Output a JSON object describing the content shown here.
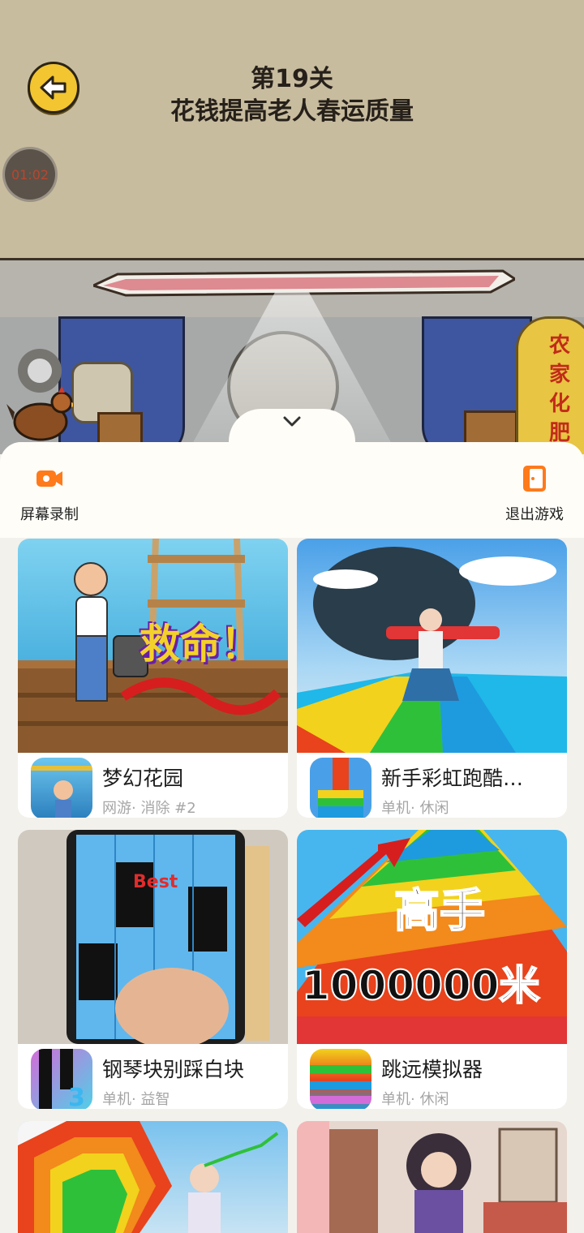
{
  "game": {
    "level_number": "第19关",
    "level_title": "花钱提高老人春运质量",
    "timer": "01:02",
    "sack_text": "农家化肥"
  },
  "toolbar": {
    "record_label": "屏幕录制",
    "exit_label": "退出游戏",
    "accent_color": "#ff7a1a"
  },
  "games": [
    {
      "name": "梦幻花园",
      "tags": "网游· 消除 #2",
      "thumb_caption": "救命！"
    },
    {
      "name": "新手彩虹跑酷…",
      "tags": "单机· 休闲"
    },
    {
      "name": "钢琴块别踩白块",
      "tags": "单机· 益智",
      "thumb_caption": "Best"
    },
    {
      "name": "跳远模拟器",
      "tags": "单机· 休闲",
      "thumb_caption_1": "高手",
      "thumb_caption_2": "1000000米"
    }
  ]
}
